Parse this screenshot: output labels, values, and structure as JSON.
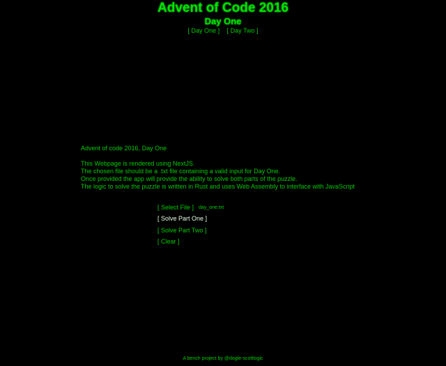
{
  "header": {
    "site_title": "Advent of Code 2016",
    "page_title": "Day One",
    "nav": [
      {
        "label": "[ Day One ]"
      },
      {
        "label": "[ Day Two ]"
      }
    ]
  },
  "intro": {
    "heading": "Advent of code 2016, Day One",
    "lines": [
      "This Webpage is rendered using NextJS.",
      "The chosen file should be a .txt file containing a valid input for Day One.",
      "Once provided the app will provide the ability to solve both parts of the puzzle.",
      "The logic to solve the puzzle is written in Rust and uses Web Assembly to interface with JavaScript"
    ]
  },
  "controls": {
    "select_file_label": "[ Select File ]",
    "selected_file": "day_one.txt",
    "solve_part_one_label": "[ Solve Part One ]",
    "solve_part_two_label": "[ Solve Part Two ]",
    "clear_label": "[ Clear ]"
  },
  "footer": {
    "text": "A bench project by @dogle-scottlogic"
  },
  "colors": {
    "background": "#000000",
    "primary_green": "#00cc00",
    "bright_green": "#00e000",
    "highlight": "#e6ffe6"
  }
}
